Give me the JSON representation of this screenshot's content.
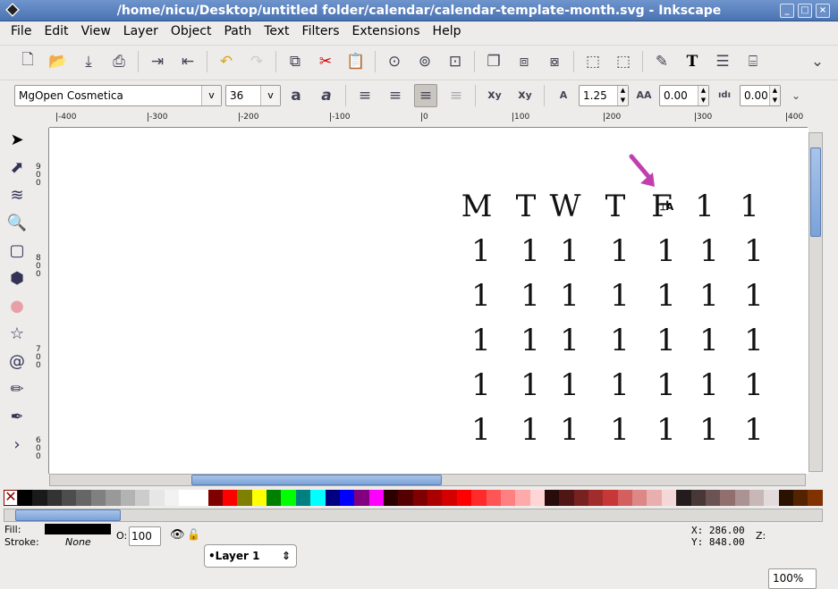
{
  "window": {
    "title": "/home/nicu/Desktop/untitled folder/calendar/calendar-template-month.svg - Inkscape"
  },
  "menu": [
    "File",
    "Edit",
    "View",
    "Layer",
    "Object",
    "Path",
    "Text",
    "Filters",
    "Extensions",
    "Help"
  ],
  "commands_bar": [
    "new-icon",
    "open-icon",
    "save-icon",
    "print-icon",
    "|",
    "import-icon",
    "export-icon",
    "|",
    "undo-icon",
    "redo-icon",
    "|",
    "copy-icon",
    "cut-icon",
    "paste-icon",
    "|",
    "zoom-selection-icon",
    "zoom-drawing-icon",
    "zoom-page-icon",
    "|",
    "duplicate-icon",
    "clone-icon",
    "unlink-clone-icon",
    "|",
    "group-icon",
    "ungroup-icon",
    "|",
    "fill-stroke-icon",
    "text-font-icon",
    "layers-icon",
    "xml-editor-icon"
  ],
  "text_toolbar": {
    "font_family": "MgOpen Cosmetica",
    "font_size": "36",
    "line_spacing": "1.25",
    "letter_spacing": "0.00",
    "word_spacing": "0.00",
    "alignment_active": "right"
  },
  "ruler": {
    "h_labels": [
      "-400",
      "-300",
      "-200",
      "-100",
      "0",
      "100",
      "200",
      "300",
      "400"
    ],
    "v_labels": [
      "900",
      "800",
      "700",
      "600"
    ]
  },
  "tools": [
    "selector",
    "node",
    "tweak",
    "zoom",
    "rectangle",
    "3d-box",
    "ellipse",
    "star",
    "spiral",
    "pencil",
    "calligraphy",
    "more"
  ],
  "canvas": {
    "header": [
      "M",
      "T",
      "W",
      "T",
      "F",
      "1",
      "1"
    ],
    "rows": [
      [
        "1",
        "1",
        "1",
        "1",
        "1",
        "1",
        "1"
      ],
      [
        "1",
        "1",
        "1",
        "1",
        "1",
        "1",
        "1"
      ],
      [
        "1",
        "1",
        "1",
        "1",
        "1",
        "1",
        "1"
      ],
      [
        "1",
        "1",
        "1",
        "1",
        "1",
        "1",
        "1"
      ],
      [
        "1",
        "1",
        "1",
        "1",
        "1",
        "1",
        "1"
      ]
    ],
    "arrow_color": "#c040b0"
  },
  "palette": [
    "#000000",
    "#1a1a1a",
    "#333333",
    "#4d4d4d",
    "#666666",
    "#808080",
    "#999999",
    "#b3b3b3",
    "#cccccc",
    "#e6e6e6",
    "#f2f2f2",
    "#ffffff",
    "#ffffff",
    "#800000",
    "#ff0000",
    "#808000",
    "#ffff00",
    "#008000",
    "#00ff00",
    "#008080",
    "#00ffff",
    "#000080",
    "#0000ff",
    "#800080",
    "#ff00ff",
    "#2b0000",
    "#550000",
    "#800000",
    "#aa0000",
    "#d40000",
    "#ff0000",
    "#ff2a2a",
    "#ff5555",
    "#ff8080",
    "#ffaaaa",
    "#ffd5d5",
    "#280b0b",
    "#501616",
    "#782121",
    "#a02c2c",
    "#c83737",
    "#d35f5f",
    "#de8787",
    "#e9afaf",
    "#f4d7d7",
    "#241c1c",
    "#483737",
    "#6c5353",
    "#916f6f",
    "#ac9393",
    "#c8b7b7",
    "#e3dbdb",
    "#2b1100",
    "#552200",
    "#803300"
  ],
  "status": {
    "fill_label": "Fill:",
    "stroke_label": "Stroke:",
    "stroke_value": "None",
    "fill_color": "#000000",
    "opacity_label": "O:",
    "opacity": "100",
    "layer": "•Layer 1",
    "x_label": "X:",
    "x": "286.00",
    "y_label": "Y:",
    "y": "848.00",
    "zoom_label": "Z:",
    "zoom": "100%"
  }
}
